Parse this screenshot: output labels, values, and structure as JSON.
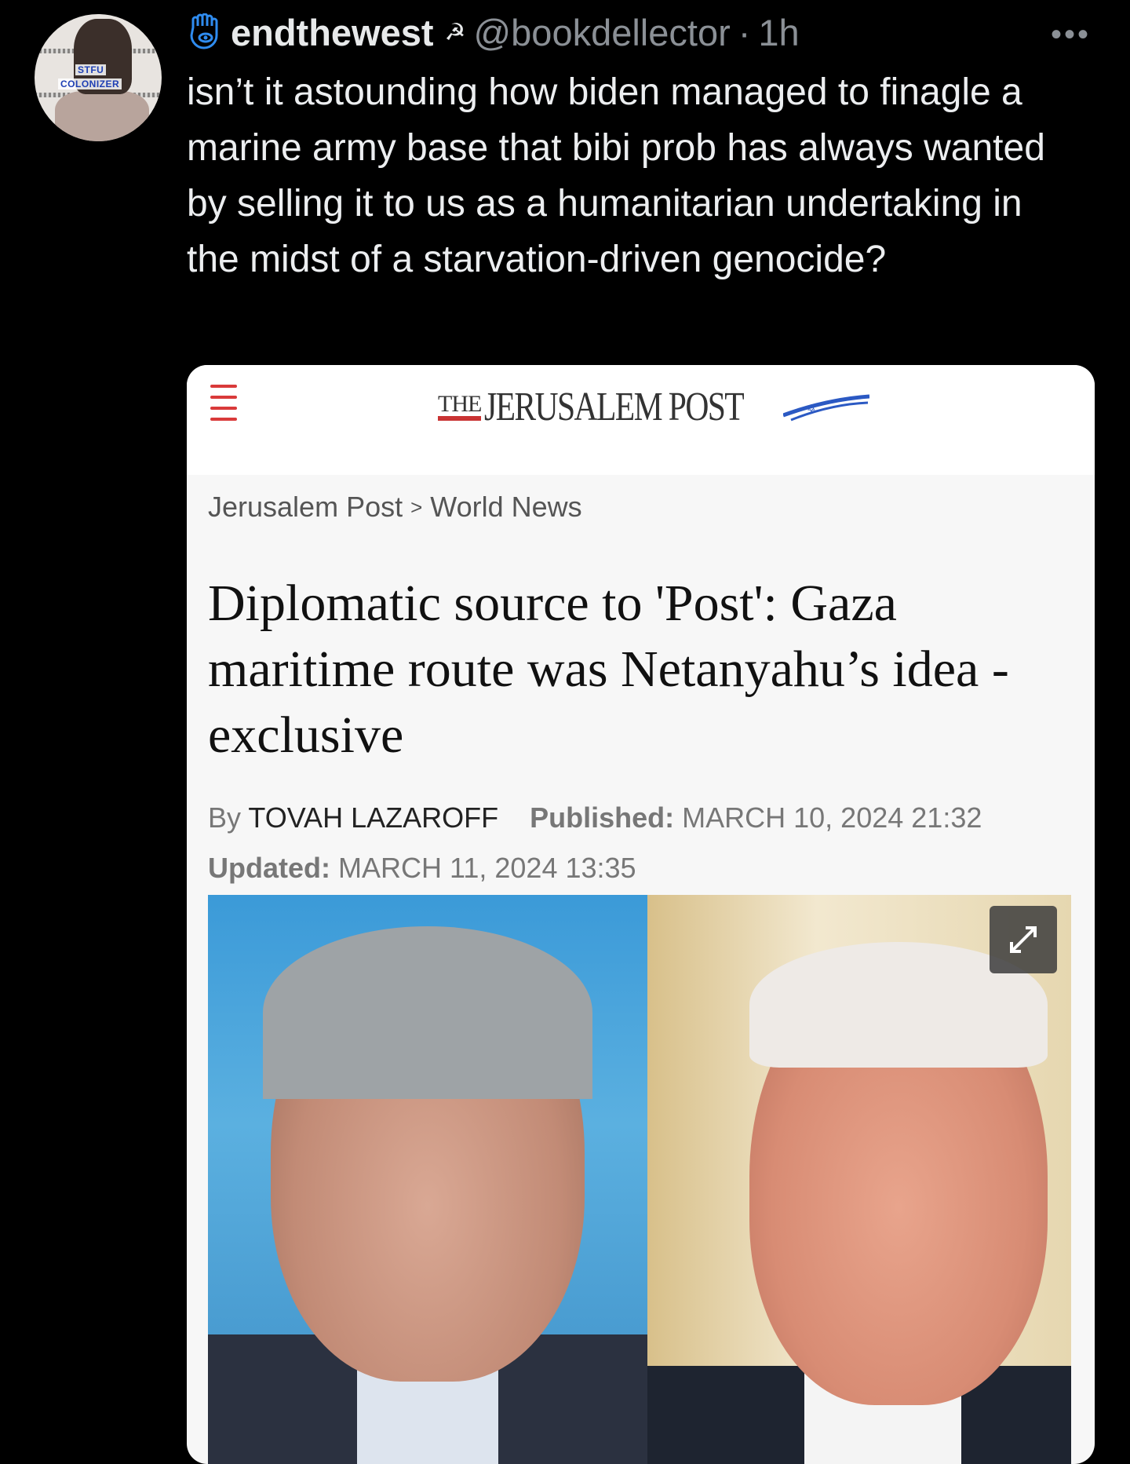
{
  "tweet": {
    "avatar": {
      "text_line1": "STFU",
      "text_line2": "COLONIZER"
    },
    "display_name": "endthewest",
    "handle": "@bookdellector",
    "separator": "·",
    "time": "1h",
    "text": "isn’t it astounding how biden managed to finagle a marine army base that bibi prob has always wanted by selling it to us as a humanitarian undertaking in the midst of a starvation-driven genocide?"
  },
  "article": {
    "logo_the": "THE",
    "logo_name": "JERUSALEM POST",
    "breadcrumb": [
      "Jerusalem Post",
      "World News"
    ],
    "breadcrumb_separator": ">",
    "headline": "Diplomatic source to 'Post': Gaza maritime route was Netanyahu’s idea - exclusive",
    "by_label": "By",
    "author": "TOVAH LAZAROFF",
    "published_label": "Published:",
    "published": "MARCH 10, 2024 21:32",
    "updated_label": "Updated:",
    "updated": "MARCH 11, 2024 13:35"
  },
  "icons": {
    "menu": "hamburger-icon",
    "more": "more-horizontal-icon",
    "expand": "expand-icon",
    "badge": "hamsa-icon",
    "name_emoji": "hammer-sickle-icon"
  },
  "colors": {
    "background": "#000000",
    "handle_gray": "#8b9096",
    "jpost_red": "#c93333",
    "card_bg": "#f7f7f7"
  }
}
